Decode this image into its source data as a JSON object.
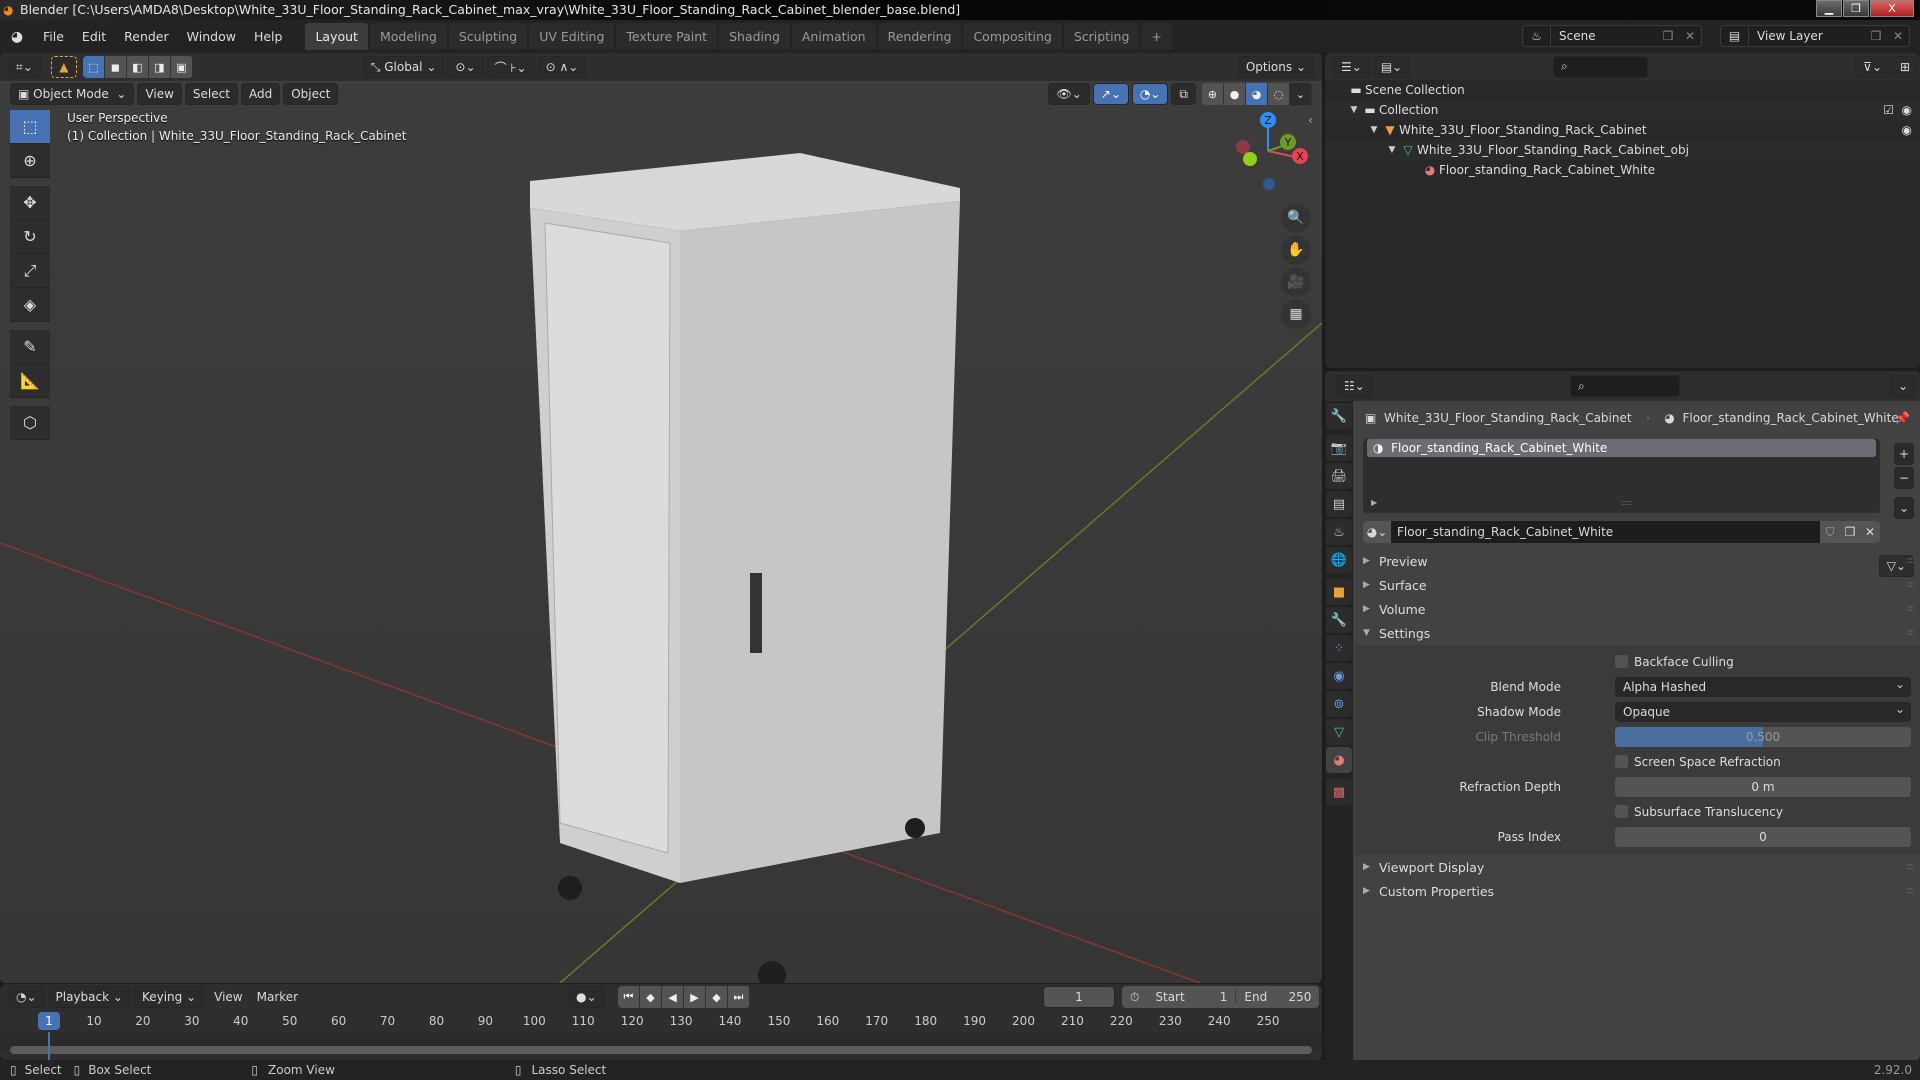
{
  "window": {
    "title": "Blender [C:\\Users\\AMDA8\\Desktop\\White_33U_Floor_Standing_Rack_Cabinet_max_vray\\White_33U_Floor_Standing_Rack_Cabinet_blender_base.blend]",
    "minimize": "▁",
    "maximize": "❐",
    "close": "X"
  },
  "menubar": {
    "items": [
      "File",
      "Edit",
      "Render",
      "Window",
      "Help"
    ],
    "workspaces": [
      "Layout",
      "Modeling",
      "Sculpting",
      "UV Editing",
      "Texture Paint",
      "Shading",
      "Animation",
      "Rendering",
      "Compositing",
      "Scripting"
    ],
    "active_workspace": "Layout",
    "add_workspace": "+",
    "scene": "Scene",
    "view_layer": "View Layer"
  },
  "viewport": {
    "transform_orientation": "Global",
    "options": "Options",
    "mode": "Object Mode",
    "menus": [
      "View",
      "Select",
      "Add",
      "Object"
    ],
    "perspective_label": "User Perspective",
    "collection_label": "(1) Collection | White_33U_Floor_Standing_Rack_Cabinet",
    "gizmo_axes": {
      "x": "X",
      "y": "Y",
      "z": "Z"
    },
    "colors": {
      "x_axis": "#e8434f",
      "y_axis": "#6d9a27",
      "z_axis": "#2c8fff",
      "accent": "#4772b3"
    }
  },
  "outliner": {
    "rows": [
      {
        "label": "Scene Collection",
        "icon": "collection-icon",
        "depth": 0
      },
      {
        "label": "Collection",
        "icon": "collection-icon",
        "depth": 1,
        "expanded": true,
        "checked": true,
        "visible": true
      },
      {
        "label": "White_33U_Floor_Standing_Rack_Cabinet",
        "icon": "object-icon",
        "depth": 2,
        "expanded": true,
        "visible": true
      },
      {
        "label": "White_33U_Floor_Standing_Rack_Cabinet_obj",
        "icon": "mesh-icon",
        "depth": 3,
        "expanded": true
      },
      {
        "label": "Floor_standing_Rack_Cabinet_White",
        "icon": "material-icon",
        "depth": 4
      }
    ]
  },
  "properties": {
    "breadcrumb_object": "White_33U_Floor_Standing_Rack_Cabinet",
    "breadcrumb_material": "Floor_standing_Rack_Cabinet_White",
    "slot_name": "Floor_standing_Rack_Cabinet_White",
    "material_name": "Floor_standing_Rack_Cabinet_White",
    "panels": {
      "preview": "Preview",
      "surface": "Surface",
      "volume": "Volume",
      "settings": "Settings",
      "viewport_display": "Viewport Display",
      "custom_properties": "Custom Properties"
    },
    "settings": {
      "backface_culling": {
        "label": "Backface Culling",
        "checked": false
      },
      "blend_mode": {
        "label": "Blend Mode",
        "value": "Alpha Hashed"
      },
      "shadow_mode": {
        "label": "Shadow Mode",
        "value": "Opaque"
      },
      "clip_threshold": {
        "label": "Clip Threshold",
        "value": "0.500",
        "fraction": 0.5
      },
      "screen_space_refraction": {
        "label": "Screen Space Refraction",
        "checked": false
      },
      "refraction_depth": {
        "label": "Refraction Depth",
        "value": "0 m"
      },
      "subsurface_translucency": {
        "label": "Subsurface Translucency",
        "checked": false
      },
      "pass_index": {
        "label": "Pass Index",
        "value": "0"
      }
    }
  },
  "timeline": {
    "menus": [
      "Playback",
      "Keying",
      "View",
      "Marker"
    ],
    "current_frame": "1",
    "start_label": "Start",
    "start": "1",
    "end_label": "End",
    "end": "250",
    "ticks": [
      "10",
      "20",
      "30",
      "40",
      "50",
      "60",
      "70",
      "80",
      "90",
      "100",
      "110",
      "120",
      "130",
      "140",
      "150",
      "160",
      "170",
      "180",
      "190",
      "200",
      "210",
      "220",
      "230",
      "240",
      "250"
    ],
    "playhead": "1"
  },
  "statusbar": {
    "select": "Select",
    "box_select": "Box Select",
    "zoom_view": "Zoom View",
    "lasso_select": "Lasso Select",
    "version": "2.92.0"
  }
}
